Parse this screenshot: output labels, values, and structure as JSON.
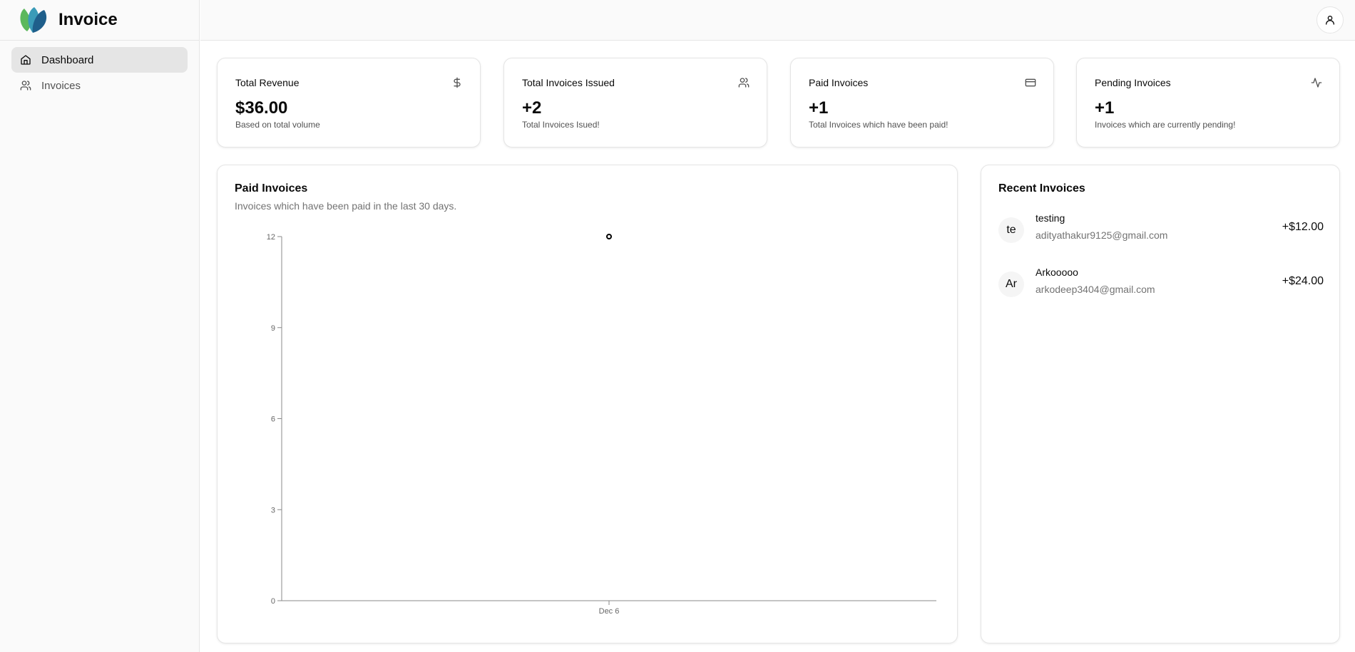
{
  "brand": {
    "title": "Invoice"
  },
  "sidebar": {
    "items": [
      {
        "label": "Dashboard",
        "icon": "home-icon",
        "active": true
      },
      {
        "label": "Invoices",
        "icon": "users-icon",
        "active": false
      }
    ]
  },
  "topbar": {
    "user_icon": "user-icon"
  },
  "stats": [
    {
      "title": "Total Revenue",
      "value": "$36.00",
      "sub": "Based on total volume",
      "icon": "dollar-icon"
    },
    {
      "title": "Total Invoices Issued",
      "value": "+2",
      "sub": "Total Invoices Isued!",
      "icon": "users-icon"
    },
    {
      "title": "Paid Invoices",
      "value": "+1",
      "sub": "Total Invoices which have been paid!",
      "icon": "credit-card-icon"
    },
    {
      "title": "Pending Invoices",
      "value": "+1",
      "sub": "Invoices which are currently pending!",
      "icon": "activity-icon"
    }
  ],
  "chart_card": {
    "title": "Paid Invoices",
    "description": "Invoices which have been paid in the last 30 days."
  },
  "chart_data": {
    "type": "line",
    "x": [
      "Dec 6"
    ],
    "series": [
      {
        "values": [
          12
        ]
      }
    ],
    "ylim": [
      0,
      12
    ],
    "yticks": [
      "0",
      "3",
      "6",
      "9",
      "12"
    ],
    "xticks": [
      "Dec 6"
    ],
    "grid": false,
    "title": "",
    "xlabel": "",
    "ylabel": ""
  },
  "recent": {
    "title": "Recent Invoices",
    "items": [
      {
        "initials": "te",
        "name": "testing",
        "email": "adityathakur9125@gmail.com",
        "amount": "+$12.00"
      },
      {
        "initials": "Ar",
        "name": "Arkooooo",
        "email": "arkodeep3404@gmail.com",
        "amount": "+$24.00"
      }
    ]
  }
}
